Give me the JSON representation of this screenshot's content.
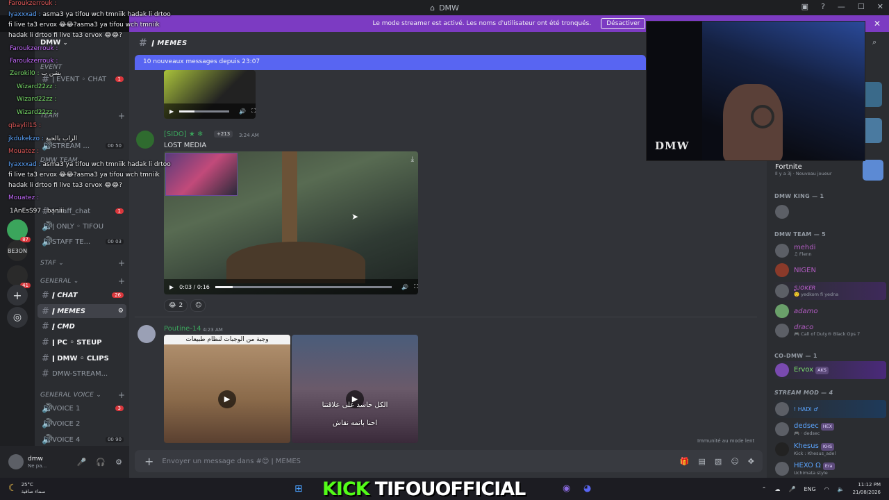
{
  "window": {
    "title": "DMW"
  },
  "banner": {
    "text": "Le mode streamer est activé. Les noms d'utilisateur ont été tronqués.",
    "button": "Désactiver"
  },
  "server": {
    "name": "DMW"
  },
  "channel_header": {
    "name": "ǀ MEMES"
  },
  "new_messages": "10 nouveaux messages depuis 23:07",
  "sidebar": {
    "event_channel": "ǀ EVENT ◦ CHAT",
    "event_cat": "EVENT",
    "stream_cat": "TEAM",
    "stream_voice": "STREAM ...",
    "stream_voice_count": "00 50",
    "dmw_team": "DMW TEAM",
    "staff_chat": "ǀ staff_chat",
    "only_tifou": "ǀ ONLY ◦ TIFOU",
    "staff_voice": "STAFF TE...",
    "staff_voice_count": "00 03",
    "staf_cat": "STAF",
    "general_cat": "GENERAL",
    "general_voice_cat": "GENERAL VOICE",
    "channels": [
      {
        "label": "ǀ CHAT",
        "count": "26"
      },
      {
        "label": "ǀ MEMES"
      },
      {
        "label": "ǀ CMD"
      },
      {
        "label": "ǀ PC ◦ STEUP"
      },
      {
        "label": "ǀ DMW ◦ CLIPS"
      },
      {
        "label": "DMW-STREAM..."
      }
    ],
    "voice": [
      {
        "label": "VOICE 1",
        "count": "3"
      },
      {
        "label": "VOICE 2"
      },
      {
        "label": "VOICE 4",
        "count": "00 90"
      }
    ]
  },
  "user": {
    "name": "dmw",
    "status": "Ne pa..."
  },
  "messages": [
    {
      "author": "[SIDO] ★ ❄",
      "badge": "+213",
      "time": "3:24 AM",
      "text": "LOST MEDIA",
      "video_time": "0:03 / 0:16",
      "video_progress": 0.1,
      "reaction_count": "2"
    },
    {
      "author": "Poutine-14",
      "time": "4:23 AM",
      "caption1": "وجبة من الوجبات لنظام طبيعات",
      "caption2": "الكل حاسد على علاقتنا",
      "caption3": "احنا باتمه نقاش"
    }
  ],
  "composer": {
    "placeholder": "Envoyer un message dans #😊 ǀ MEMES"
  },
  "slowmode": "Immunité au mode lent",
  "members": {
    "game_name": "Fortnite",
    "game_sub": "Il y a 3j  ·  Nouveau joueur",
    "groups": [
      {
        "title": "DMW KING — 1"
      },
      {
        "title": "DMW TEAM — 5"
      },
      {
        "title": "CO-DMW — 1"
      },
      {
        "title": "STREAM MOD — 4"
      }
    ],
    "team": [
      {
        "name": "mehdi",
        "sub": "♫ Flenn",
        "color": "#b45cc4"
      },
      {
        "name": "NIGEN",
        "sub": "",
        "color": "#b45cc4"
      },
      {
        "name": "ʂᴊᴏᴋᴇʀ",
        "sub": "🙂 yedkom fi yedna",
        "color": "#b45cc4"
      },
      {
        "name": "adamo",
        "sub": "",
        "color": "#b45cc4"
      },
      {
        "name": "draco",
        "sub": "🎮 Call of Duty® Black Ops 7",
        "color": "#b45cc4"
      }
    ],
    "codmw": [
      {
        "name": "Ervox",
        "tag": "AKS",
        "color": "#7be06b"
      }
    ],
    "mods": [
      {
        "name": "! HADI ♂",
        "sub": "",
        "color": "#5ba5ff"
      },
      {
        "name": "dedsec",
        "tag": "HEX",
        "sub": "🎮 · dedsec",
        "color": "#5ba5ff"
      },
      {
        "name": "Khesus",
        "tag": "KHS",
        "sub": "Kick : Khesus_adel",
        "color": "#5ba5ff"
      },
      {
        "name": "HEXO Ω",
        "tag": "Era",
        "sub": "Uchimata style",
        "color": "#5ba5ff"
      }
    ]
  },
  "webcam": {
    "watermark": "DMW"
  },
  "overlay": [
    {
      "user": "Faroukzerrouk :",
      "text": ""
    },
    {
      "user": "Iyaxxxad :",
      "text": "asma3 ya tifou wch tmniik hadak li drtoo"
    },
    {
      "user": "",
      "text": "fi live ta3 ervox 😂😂?asma3 ya tifou wch tmniik"
    },
    {
      "user": "",
      "text": "hadak li drtoo fi live ta3 ervox 😂😂?"
    },
    {
      "user": "Faroukzerrouk :",
      "text": ""
    },
    {
      "user": "Faroukzerrouk :",
      "text": ""
    },
    {
      "user": "Zerokil0 :",
      "text": "بشن ب"
    },
    {
      "user": "Wizard22zz :",
      "text": ""
    },
    {
      "user": "Wizard22zz :",
      "text": ""
    },
    {
      "user": "Wizard22zz :",
      "text": ""
    },
    {
      "user": "qbaylil15 :",
      "text": ""
    },
    {
      "user": "jkdukekzo :",
      "text": "الراب بالحبة"
    },
    {
      "user": "Mouatez :",
      "text": ""
    },
    {
      "user": "Iyaxxxad :",
      "text": "asma3 ya tifou wch tmniik hadak li drtoo"
    },
    {
      "user": "",
      "text": "fi live ta3 ervox 😂😂?asma3 ya tifou wch tmniik"
    },
    {
      "user": "",
      "text": "hadak li drtoo fi live ta3 ervox 😂😂?"
    },
    {
      "user": "Mouatez :",
      "text": ""
    },
    {
      "user": "1AnEsS97 :",
      "text": "baniii"
    }
  ],
  "taskbar": {
    "weather_temp": "25°C",
    "weather_desc": "سماء صافية",
    "kick_label": "KICK",
    "channel_label": "TIFOUOFFICIAL",
    "lang": "ENG",
    "time": "11:12 PM",
    "date": "21/08/2026"
  },
  "colors": {
    "accent": "#5865f2",
    "banner": "#7c3bc2",
    "kick": "#53fc18"
  }
}
